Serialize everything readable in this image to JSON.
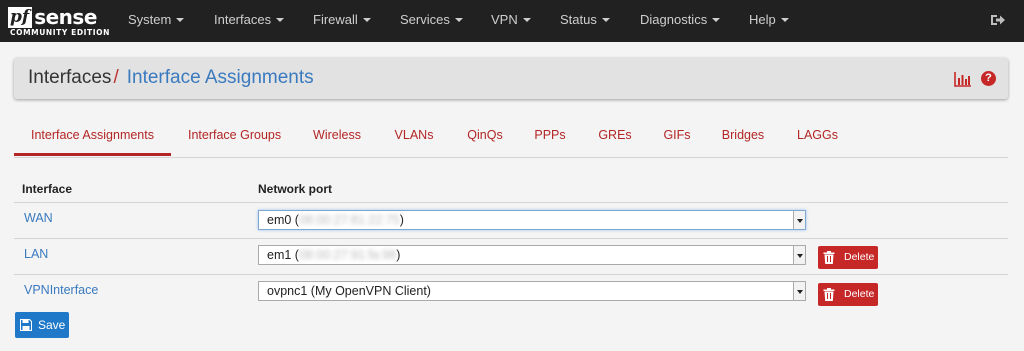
{
  "brand": {
    "logo_pf": "pf",
    "logo_sense": "sense",
    "logo_sub": "COMMUNITY EDITION"
  },
  "nav": {
    "items": [
      "System",
      "Interfaces",
      "Firewall",
      "Services",
      "VPN",
      "Status",
      "Diagnostics",
      "Help"
    ]
  },
  "header": {
    "parent": "Interfaces",
    "separator": "/",
    "current": "Interface Assignments",
    "help_glyph": "?"
  },
  "tabs": [
    {
      "label": "Interface Assignments",
      "active": true
    },
    {
      "label": "Interface Groups"
    },
    {
      "label": "Wireless"
    },
    {
      "label": "VLANs"
    },
    {
      "label": "QinQs"
    },
    {
      "label": "PPPs"
    },
    {
      "label": "GREs"
    },
    {
      "label": "GIFs"
    },
    {
      "label": "Bridges"
    },
    {
      "label": "LAGGs"
    }
  ],
  "table": {
    "col_interface": "Interface",
    "col_port": "Network port",
    "rows": [
      {
        "interface": "WAN",
        "port_prefix": "em0 (",
        "port_mac": "08:00:27:81:22:75",
        "port_suffix": ")"
      },
      {
        "interface": "LAN",
        "port_prefix": "em1 (",
        "port_mac": "08:00:27:91:fa:98",
        "port_suffix": ")",
        "delete_label": "Delete"
      },
      {
        "interface": "VPNInterface",
        "port_prefix": "ovpnc1 (My OpenVPN Client)",
        "port_mac": "",
        "port_suffix": "",
        "delete_label": "Delete"
      }
    ]
  },
  "save_label": "Save",
  "colors": {
    "accent_red": "#b42525",
    "link_blue": "#3a7abf",
    "navbar": "#212121",
    "save_blue": "#1f78c8"
  },
  "icons": {
    "logout": "sign-out-icon",
    "chart": "bar-chart-icon",
    "help": "question-circle-icon",
    "delete": "trash-icon",
    "save": "floppy-disk-icon"
  }
}
